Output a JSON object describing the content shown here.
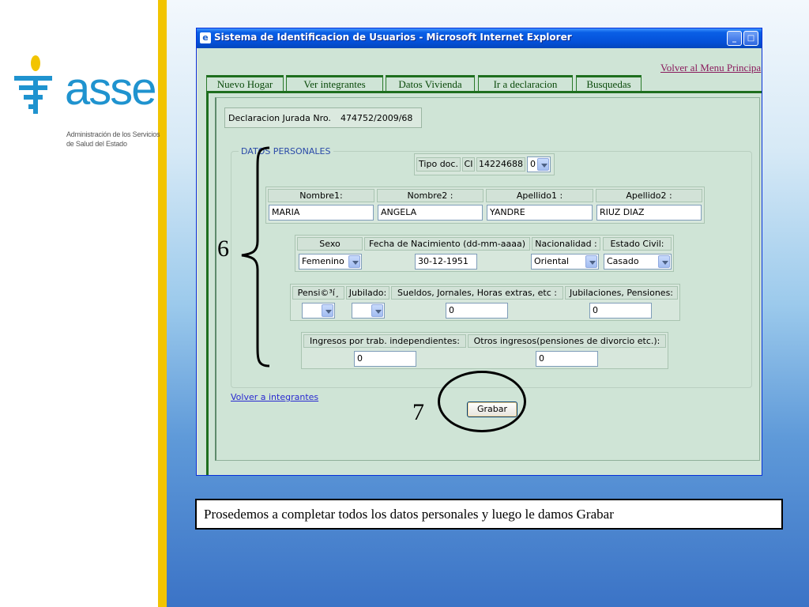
{
  "logo": {
    "brand": "asse",
    "subtitle_line1": "Administración de los Servicios",
    "subtitle_line2": "de Salud del Estado",
    "color": "#1f93cf"
  },
  "browser": {
    "title": "Sistema de Identificacion de Usuarios - Microsoft Internet Explorer",
    "menu_link": "Volver al Menu Principa"
  },
  "tabs": [
    "Nuevo Hogar",
    "Ver integrantes",
    "Datos Vivienda",
    "Ir a declaracion",
    "Busquedas"
  ],
  "form": {
    "declaracion_label": "Declaracion Jurada Nro.",
    "declaracion_value": "474752/2009/68",
    "legend": "DATOS PERSONALES",
    "tipo_doc_label": "Tipo doc.",
    "tipo_doc_type": "CI",
    "tipo_doc_number": "14224688",
    "tipo_doc_digit": "0",
    "name_headers": [
      "Nombre1:",
      "Nombre2 :",
      "Apellido1 :",
      "Apellido2 :"
    ],
    "name_values": [
      "MARIA",
      "ANGELA",
      "YANDRE",
      "RIUZ DIAZ"
    ],
    "row3_headers": [
      "Sexo",
      "Fecha de Nacimiento (dd-mm-aaaa)",
      "Nacionalidad :",
      "Estado Civil:"
    ],
    "sexo": "Femenino",
    "fecha": "30-12-1951",
    "nacionalidad": "Oriental",
    "estado_civil": "Casado",
    "row4_headers": [
      "Pensi©³í¸",
      "Jubilado:",
      "Sueldos, Jornales, Horas extras, etc :",
      "Jubilaciones, Pensiones:"
    ],
    "sueldos": "0",
    "jubilaciones": "0",
    "row5_headers": [
      "Ingresos por trab. independientes:",
      "Otros ingresos(pensiones de divorcio etc.):"
    ],
    "ingresos_indep": "0",
    "otros_ingresos": "0",
    "volver_link": "Volver a integrantes",
    "grabar_button": "Grabar"
  },
  "annotations": {
    "brace_number": "6",
    "circle_number": "7"
  },
  "caption": "Prosedemos a completar todos los datos personales y luego le damos Grabar",
  "colors": {
    "accent_yellow": "#f2c400",
    "tab_green": "#1e6e1e",
    "page_green": "#cfe4d6",
    "titlebar_blue": "#0450d8"
  }
}
